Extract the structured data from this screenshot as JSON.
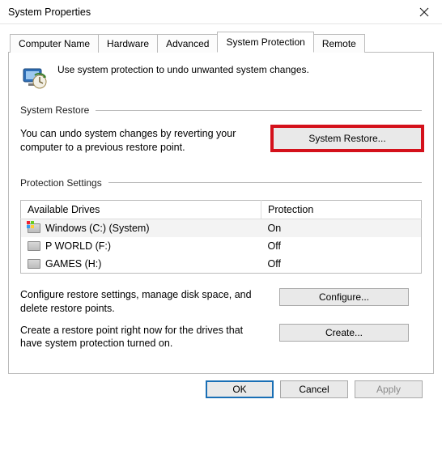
{
  "window": {
    "title": "System Properties"
  },
  "tabs": {
    "t0": "Computer Name",
    "t1": "Hardware",
    "t2": "Advanced",
    "t3": "System Protection",
    "t4": "Remote"
  },
  "intro": "Use system protection to undo unwanted system changes.",
  "restore": {
    "heading": "System Restore",
    "desc": "You can undo system changes by reverting your computer to a previous restore point.",
    "button": "System Restore..."
  },
  "protection": {
    "heading": "Protection Settings",
    "col_drive": "Available Drives",
    "col_status": "Protection",
    "rows": [
      {
        "name": "Windows (C:) (System)",
        "status": "On",
        "type": "win"
      },
      {
        "name": "P WORLD (F:)",
        "status": "Off",
        "type": "hdd"
      },
      {
        "name": "GAMES (H:)",
        "status": "Off",
        "type": "hdd"
      }
    ],
    "configure_desc": "Configure restore settings, manage disk space, and delete restore points.",
    "configure_btn": "Configure...",
    "create_desc": "Create a restore point right now for the drives that have system protection turned on.",
    "create_btn": "Create..."
  },
  "buttons": {
    "ok": "OK",
    "cancel": "Cancel",
    "apply": "Apply"
  }
}
